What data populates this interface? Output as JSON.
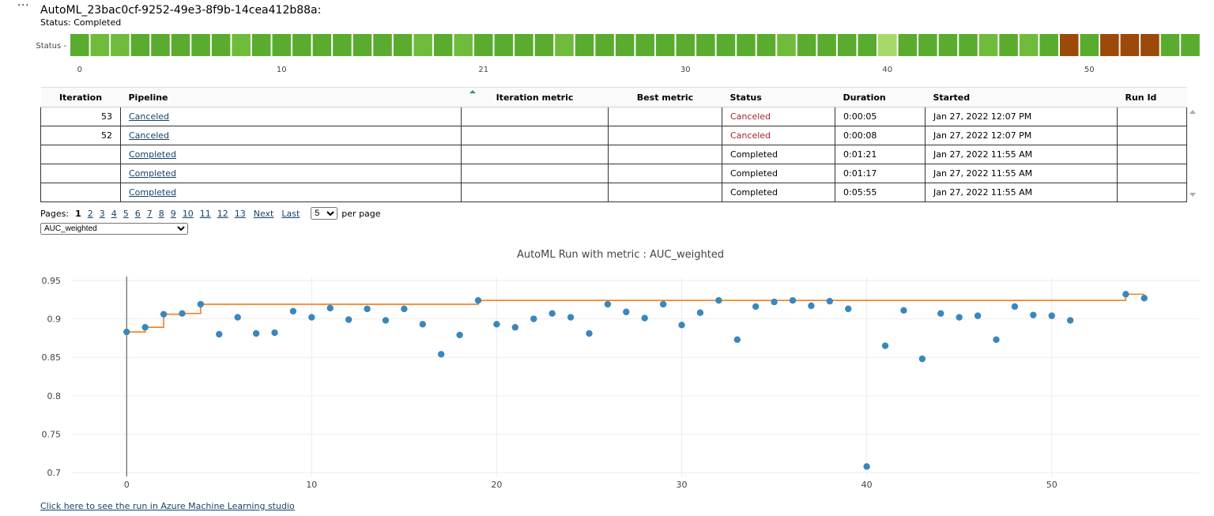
{
  "header": {
    "menu_glyph": "···",
    "run_title": "AutoML_23bac0cf-9252-49e3-8f9b-14cea412b88a:",
    "run_status": "Status: Completed"
  },
  "status_strip": {
    "axis_label": "Status -",
    "tick_labels": [
      "0",
      "10",
      "21",
      "30",
      "40",
      "50"
    ],
    "cell_status": [
      "C",
      "C",
      "C",
      "C",
      "C",
      "C",
      "C",
      "C",
      "C",
      "C",
      "C",
      "C",
      "C",
      "C",
      "C",
      "C",
      "C",
      "C",
      "C",
      "C",
      "C",
      "C",
      "C",
      "C",
      "C",
      "C",
      "C",
      "C",
      "C",
      "C",
      "C",
      "C",
      "C",
      "C",
      "C",
      "C",
      "C",
      "C",
      "C",
      "C",
      "C",
      "C",
      "C",
      "C",
      "C",
      "C",
      "C",
      "C",
      "C",
      "X",
      "C",
      "X",
      "X",
      "X",
      "C",
      "C"
    ],
    "cell_colors": {
      "C": "#5aac2e",
      "X": "#9c4a0a",
      "light": "#a8d86a",
      "mid": "#6fbc3c"
    }
  },
  "table": {
    "headers": {
      "iteration": "Iteration",
      "pipeline": "Pipeline",
      "metric": "Iteration metric",
      "best": "Best metric",
      "status": "Status",
      "duration": "Duration",
      "started": "Started",
      "run_id": "Run Id"
    },
    "rows": [
      {
        "iteration": "53",
        "pipeline": "Canceled",
        "metric": "",
        "best": "",
        "status": "Canceled",
        "duration": "0:00:05",
        "started": "Jan 27, 2022 12:07 PM",
        "run_id": ""
      },
      {
        "iteration": "52",
        "pipeline": "Canceled",
        "metric": "",
        "best": "",
        "status": "Canceled",
        "duration": "0:00:08",
        "started": "Jan 27, 2022 12:07 PM",
        "run_id": ""
      },
      {
        "iteration": "",
        "pipeline": "Completed",
        "metric": "",
        "best": "",
        "status": "Completed",
        "duration": "0:01:21",
        "started": "Jan 27, 2022 11:55 AM",
        "run_id": ""
      },
      {
        "iteration": "",
        "pipeline": "Completed",
        "metric": "",
        "best": "",
        "status": "Completed",
        "duration": "0:01:17",
        "started": "Jan 27, 2022 11:55 AM",
        "run_id": ""
      },
      {
        "iteration": "",
        "pipeline": "Completed",
        "metric": "",
        "best": "",
        "status": "Completed",
        "duration": "0:05:55",
        "started": "Jan 27, 2022 11:55 AM",
        "run_id": ""
      }
    ]
  },
  "pager": {
    "label": "Pages:",
    "current": "1",
    "pages": [
      "2",
      "3",
      "4",
      "5",
      "6",
      "7",
      "8",
      "9",
      "10",
      "11",
      "12",
      "13"
    ],
    "next": "Next",
    "last": "Last",
    "page_size": "5",
    "per_page": "per page"
  },
  "metric_select": {
    "value": "AUC_weighted"
  },
  "chart_data": {
    "type": "scatter",
    "title": "AutoML Run with metric : AUC_weighted",
    "xlabel": "",
    "ylabel": "",
    "xlim": [
      -3,
      58
    ],
    "ylim": [
      0.695,
      0.955
    ],
    "x_ticks": [
      "0",
      "10",
      "20",
      "30",
      "40",
      "50"
    ],
    "y_ticks": [
      "0.95",
      "0.9",
      "0.85",
      "0.8",
      "0.75",
      "0.7"
    ],
    "grid": true,
    "colors": {
      "points": "#3a87bd",
      "best_line": "#f07f1e"
    },
    "series": [
      {
        "type": "scatter",
        "x": [
          0,
          1,
          2,
          3,
          4,
          5,
          6,
          7,
          8,
          9,
          10,
          11,
          12,
          13,
          14,
          15,
          16,
          17,
          18,
          19,
          20,
          21,
          22,
          23,
          24,
          25,
          26,
          27,
          28,
          29,
          30,
          31,
          32,
          33,
          34,
          35,
          36,
          37,
          38,
          39,
          40,
          41,
          42,
          43,
          44,
          45,
          46,
          47,
          48,
          49,
          50,
          51,
          54,
          55
        ],
        "y": [
          0.883,
          0.889,
          0.906,
          0.907,
          0.919,
          0.88,
          0.902,
          0.881,
          0.882,
          0.91,
          0.902,
          0.914,
          0.899,
          0.913,
          0.898,
          0.913,
          0.893,
          0.854,
          0.879,
          0.924,
          0.893,
          0.889,
          0.9,
          0.907,
          0.902,
          0.881,
          0.919,
          0.909,
          0.901,
          0.919,
          0.892,
          0.908,
          0.924,
          0.873,
          0.916,
          0.922,
          0.924,
          0.917,
          0.923,
          0.913,
          0.708,
          0.865,
          0.911,
          0.848,
          0.907,
          0.902,
          0.904,
          0.873,
          0.916,
          0.905,
          0.904,
          0.898,
          0.932,
          0.927
        ]
      },
      {
        "type": "step-line",
        "x": [
          0,
          1,
          2,
          3,
          4,
          19,
          54,
          55
        ],
        "y": [
          0.883,
          0.889,
          0.906,
          0.907,
          0.919,
          0.924,
          0.932,
          0.932
        ]
      }
    ]
  },
  "footer": {
    "studio_link": "Click here to see the run in Azure Machine Learning studio"
  }
}
